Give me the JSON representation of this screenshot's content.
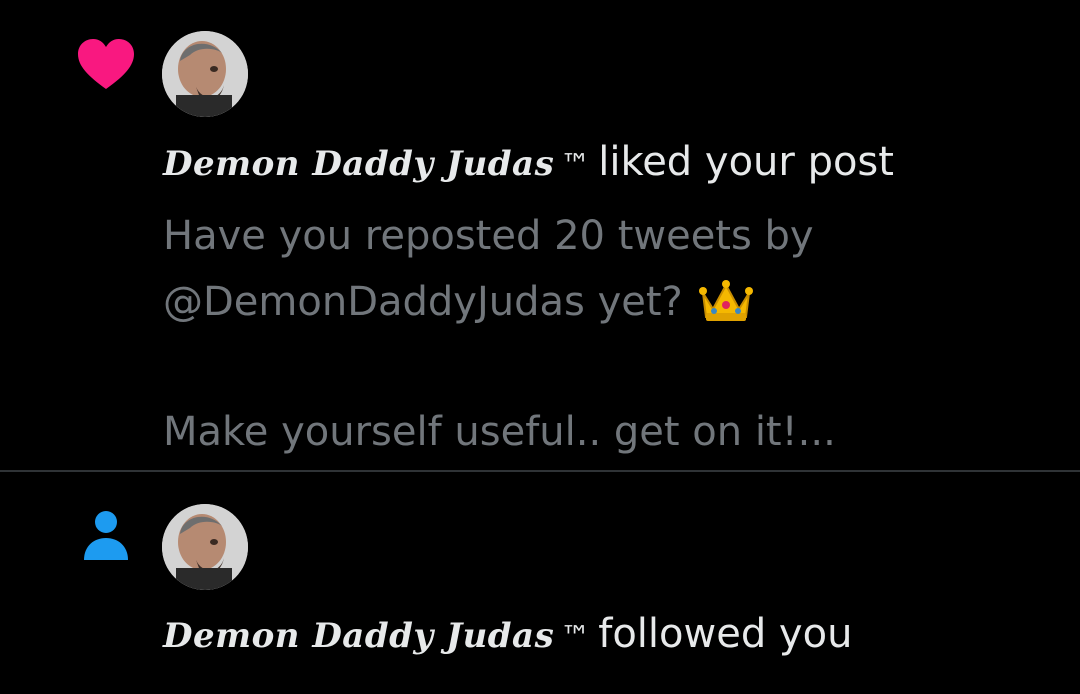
{
  "notifications": [
    {
      "type_icon": "heart-icon",
      "user_name": "Demon Daddy Judas",
      "user_suffix": "™",
      "action": "liked your post",
      "post_preview": {
        "line1": "Have you reposted 20 tweets by",
        "line2": "@DemonDaddyJudas yet?",
        "line2_emoji": "crown-emoji",
        "line3": "Make yourself useful.. get on it!..."
      }
    },
    {
      "type_icon": "person-icon",
      "user_name": "Demon Daddy Judas",
      "user_suffix": "™",
      "action": "followed you"
    }
  ],
  "colors": {
    "background": "#000000",
    "heart": "#f91880",
    "person": "#1d9bf0",
    "primary_text": "#e7e9ea",
    "secondary_text": "#71767b",
    "divider": "#2f3336"
  }
}
